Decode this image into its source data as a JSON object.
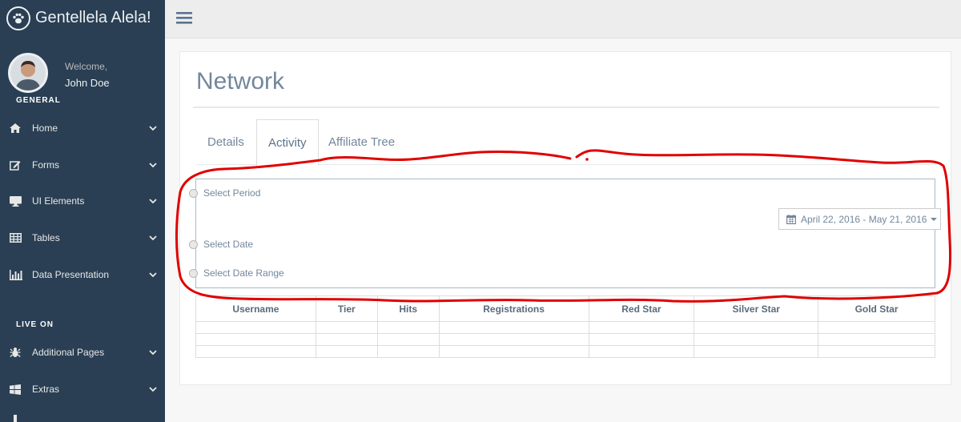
{
  "app": {
    "title": "Gentellela Alela!",
    "logo_icon": "paw-icon"
  },
  "profile": {
    "welcome": "Welcome,",
    "name": "John Doe"
  },
  "sidebar": {
    "section_general": "GENERAL",
    "section_live": "LIVE ON",
    "items": [
      {
        "label": "Home",
        "icon": "home-icon"
      },
      {
        "label": "Forms",
        "icon": "edit-icon"
      },
      {
        "label": "UI Elements",
        "icon": "desktop-icon"
      },
      {
        "label": "Tables",
        "icon": "table-icon"
      },
      {
        "label": "Data Presentation",
        "icon": "bar-chart-icon"
      },
      {
        "label": "Additional Pages",
        "icon": "bug-icon"
      },
      {
        "label": "Extras",
        "icon": "windows-icon"
      }
    ]
  },
  "page": {
    "title": "Network",
    "tabs": [
      {
        "label": "Details",
        "active": false
      },
      {
        "label": "Activity",
        "active": true
      },
      {
        "label": "Affiliate Tree",
        "active": false
      }
    ]
  },
  "filters": {
    "select_period": "Select Period",
    "select_date": "Select Date",
    "select_date_range": "Select Date Range",
    "date_range_value": "April 22, 2016 - May 21, 2016"
  },
  "table": {
    "columns": [
      "Username",
      "Tier",
      "Hits",
      "Registrations",
      "Red Star",
      "Silver Star",
      "Gold Star"
    ],
    "rows": [
      [
        "",
        "",
        "",
        "",
        "",
        "",
        ""
      ],
      [
        "",
        "",
        "",
        "",
        "",
        "",
        ""
      ],
      [
        "",
        "",
        "",
        "",
        "",
        "",
        ""
      ]
    ]
  },
  "colors": {
    "sidebar_bg": "#2A3F54",
    "annotation": "#E00000",
    "text_muted": "#73879C"
  }
}
